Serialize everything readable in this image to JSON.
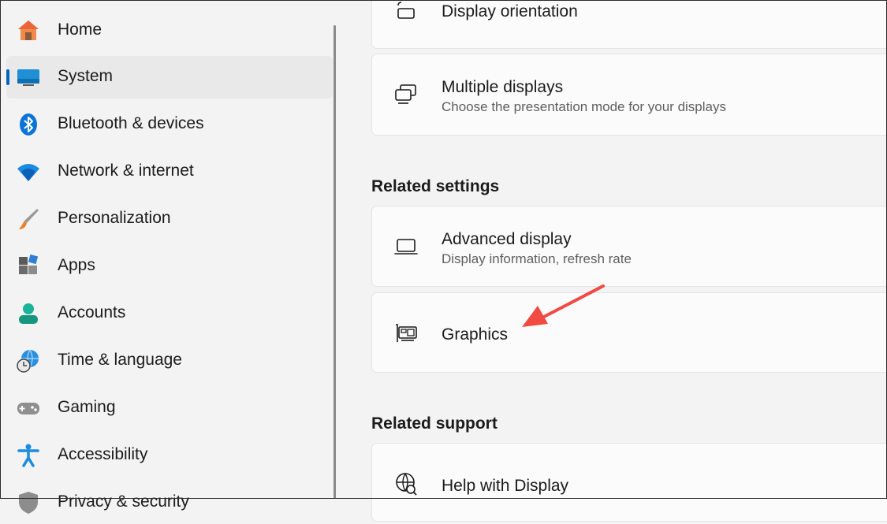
{
  "sidebar": {
    "items": [
      {
        "label": "Home",
        "icon": "home-icon"
      },
      {
        "label": "System",
        "icon": "system-icon",
        "active": true
      },
      {
        "label": "Bluetooth & devices",
        "icon": "bluetooth-icon"
      },
      {
        "label": "Network & internet",
        "icon": "wifi-icon"
      },
      {
        "label": "Personalization",
        "icon": "brush-icon"
      },
      {
        "label": "Apps",
        "icon": "apps-icon"
      },
      {
        "label": "Accounts",
        "icon": "accounts-icon"
      },
      {
        "label": "Time & language",
        "icon": "globe-clock-icon"
      },
      {
        "label": "Gaming",
        "icon": "gamepad-icon"
      },
      {
        "label": "Accessibility",
        "icon": "accessibility-icon"
      },
      {
        "label": "Privacy & security",
        "icon": "shield-icon"
      }
    ]
  },
  "main": {
    "display_orientation": {
      "title": "Display orientation",
      "icon": "rotate-screen-icon"
    },
    "multiple_displays": {
      "title": "Multiple displays",
      "subtitle": "Choose the presentation mode for your displays",
      "icon": "multiple-displays-icon"
    },
    "related_settings": {
      "heading": "Related settings",
      "advanced_display": {
        "title": "Advanced display",
        "subtitle": "Display information, refresh rate",
        "icon": "laptop-icon"
      },
      "graphics": {
        "title": "Graphics",
        "icon": "graphics-card-icon"
      }
    },
    "related_support": {
      "heading": "Related support",
      "help_display": {
        "title": "Help with Display",
        "icon": "globe-search-icon"
      }
    }
  },
  "colors": {
    "accent": "#0067c0",
    "annotation_arrow": "#f04a42"
  }
}
